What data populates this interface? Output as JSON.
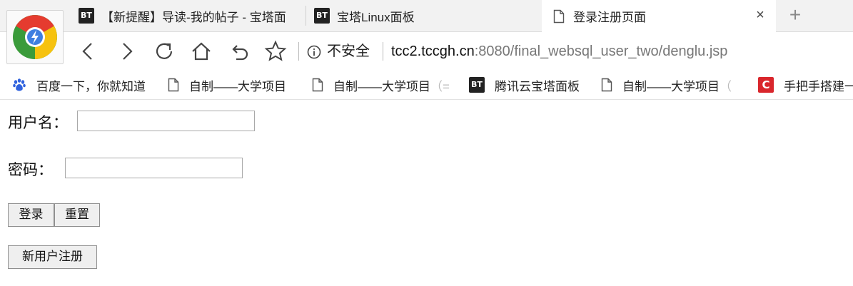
{
  "browser": {
    "tabs": [
      {
        "icon": "BT",
        "label": "【新提醒】导读-我的帖子 - 宝塔面"
      },
      {
        "icon": "BT",
        "label": "宝塔Linux面板"
      },
      {
        "icon": "document-icon",
        "label": "登录注册页面",
        "active": true
      }
    ],
    "close_tab_symbol": "×",
    "new_tab_symbol": "+",
    "security_label": "不安全",
    "url_host": "tcc2.tccgh.cn",
    "url_rest": ":8080/final_websql_user_two/denglu.jsp",
    "bookmarks": [
      {
        "icon": "baidu-paw-icon",
        "label": "百度一下，你就知道"
      },
      {
        "icon": "document-icon",
        "label": "自制——大学项目"
      },
      {
        "icon": "document-icon",
        "label": "自制——大学项目",
        "faded_suffix": "（="
      },
      {
        "icon": "BT",
        "label": "腾讯云宝塔面板"
      },
      {
        "icon": "document-icon",
        "label": "自制——大学项目",
        "faded_suffix": "（"
      },
      {
        "icon": "C",
        "label": "手把手搭建一"
      }
    ]
  },
  "form": {
    "username_label": "用户名：",
    "username_value": "",
    "password_label": "密码：",
    "password_value": "",
    "login_button": "登录",
    "reset_button": "重置",
    "register_button": "新用户注册"
  },
  "colors": {
    "tab_strip": "#f2f2f2",
    "bt_badge": "#222222",
    "csdn_badge": "#d9262c",
    "button_bg": "#efefef"
  }
}
